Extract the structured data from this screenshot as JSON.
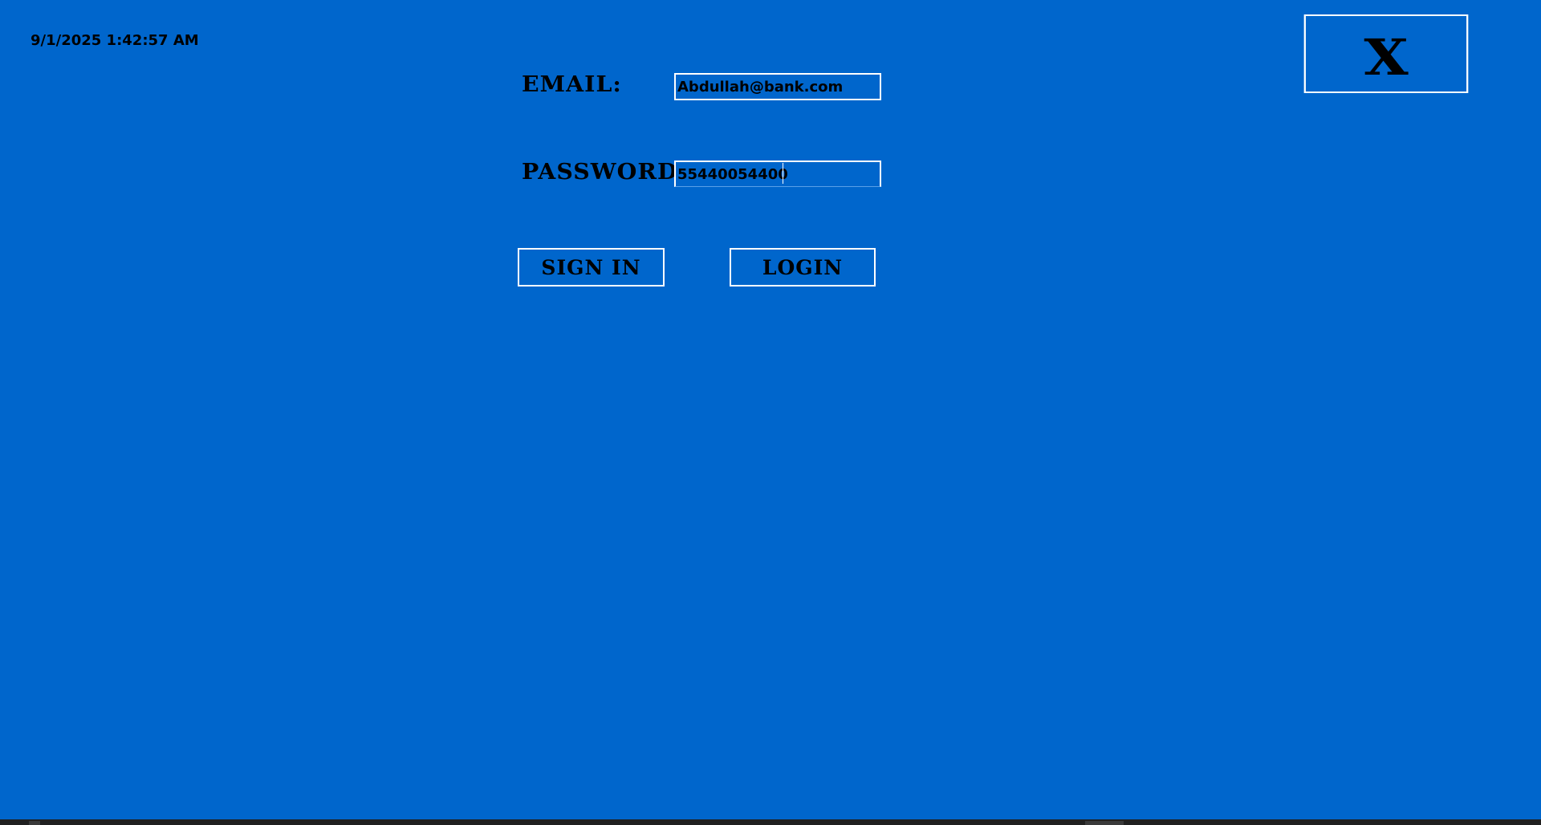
{
  "clock": {
    "datetime": "9/1/2025 1:42:57 AM"
  },
  "close_button": {
    "label": "X"
  },
  "form": {
    "email_label": "EMAIL:",
    "email_value": "Abdullah@bank.com",
    "password_label": "PASSWORD:",
    "password_value": "55440054400"
  },
  "actions": {
    "signin_label": "SIGN IN",
    "login_label": "LOGIN"
  },
  "colors": {
    "background": "#0066cc",
    "border": "#ffffff",
    "text": "#000000",
    "taskbar": "#202020"
  }
}
